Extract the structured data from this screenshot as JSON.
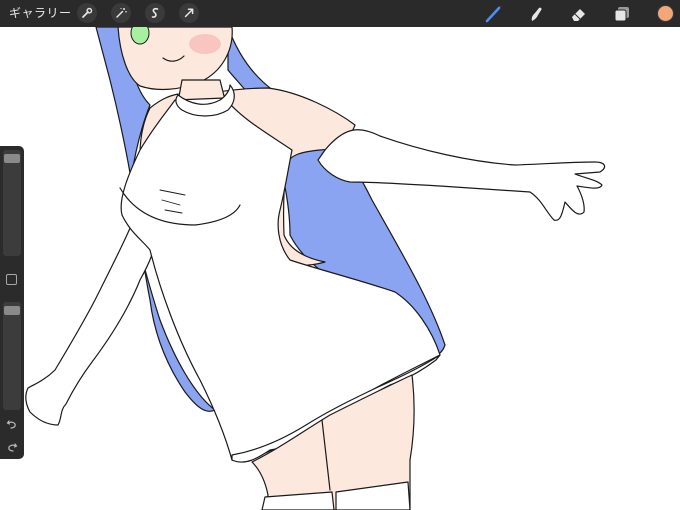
{
  "toolbar": {
    "gallery_label": "ギャラリー",
    "left_tools": [
      "wrench-icon",
      "magic-wand-icon",
      "selection-icon",
      "transform-arrow-icon"
    ],
    "right_tools": [
      "brush-icon",
      "smudge-icon",
      "eraser-icon",
      "layers-icon"
    ],
    "active_tool": "brush-icon",
    "active_color": "#f3a678",
    "accent_color": "#4a90f2"
  },
  "sidebar": {
    "brush_size": 0.97,
    "brush_opacity": 0.97,
    "icons": [
      "modify-square-icon",
      "undo-icon",
      "redo-icon"
    ]
  },
  "canvas": {
    "hair_color": "#8aa4f2",
    "skin_color": "#fde8dd",
    "dress_color": "#ffffff",
    "eye_color": "#a6f0a0",
    "blush_color": "#f7b9b6"
  }
}
